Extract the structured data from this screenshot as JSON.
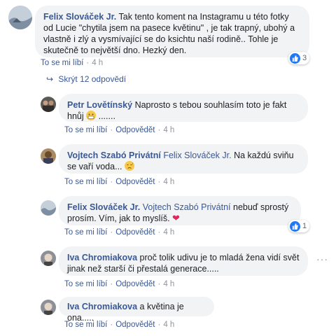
{
  "comments": [
    {
      "author": "Felix Slováček Jr.",
      "text": "Tak tento koment na Instagramu u této fotky od Lucie \"chytila jsem na pasece květinu\" , je tak trapný, ubohý a vlastně i zlý a vysmívající se do ksichtu naší rodině.. Tohle je skutečně to největší dno. Hezký den.",
      "actions": {
        "like": "To se mi líbí",
        "time": "4 h"
      },
      "reaction_count": "3"
    },
    {
      "author": "Petr Lovětínský",
      "text": "Naprosto s tebou souhlasím toto je fakt hnůj",
      "text_tail": ".......",
      "actions": {
        "like": "To se mi líbí",
        "reply": "Odpovědět",
        "time": "4 h"
      }
    },
    {
      "author": "Vojtech Szabó Privátní",
      "mention": "Felix Slováček Jr.",
      "text": "Na každú sviňu se vaří voda...",
      "actions": {
        "like": "To se mi líbí",
        "reply": "Odpovědět",
        "time": "4 h"
      }
    },
    {
      "author": "Felix Slováček Jr.",
      "mention": "Vojtech Szabó Privátní",
      "text": "nebuď sprostý prosím. Vím, jak to myslíš.",
      "actions": {
        "like": "To se mi líbí",
        "reply": "Odpovědět",
        "time": "4 h"
      },
      "reaction_count": "1"
    },
    {
      "author": "Iva Chromiakova",
      "text": "proč tolik udivu je to mladá žena vidí svět jinak než starší či přestalá generace.....",
      "actions": {
        "like": "To se mi líbí",
        "reply": "Odpovědět",
        "time": "4 h"
      }
    },
    {
      "author": "Iva Chromiakova",
      "text": "a květina je ona.....",
      "actions": {
        "like": "To se mi líbí",
        "reply": "Odpovědět",
        "time": "4 h"
      }
    }
  ],
  "hide_replies": "Skrýt 12 odpovědí",
  "colors": {
    "link": "#385898",
    "bubble": "#f2f3f5",
    "like_blue": "#2078f4",
    "heart": "#e0245e",
    "muted": "#90949c"
  }
}
